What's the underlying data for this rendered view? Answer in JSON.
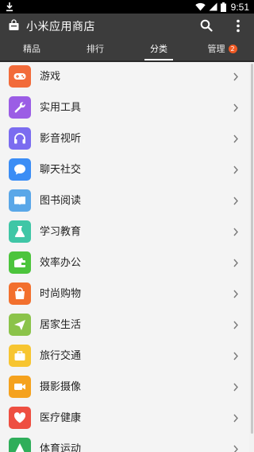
{
  "status_bar": {
    "time": "9:51"
  },
  "app_bar": {
    "title": "小米应用商店"
  },
  "tabs": [
    {
      "label": "精品"
    },
    {
      "label": "排行"
    },
    {
      "label": "分类"
    },
    {
      "label": "管理",
      "badge": "2"
    }
  ],
  "active_tab": "分类",
  "categories": [
    {
      "label": "游戏",
      "icon": "gamepad-icon",
      "color": "#f26b3a"
    },
    {
      "label": "实用工具",
      "icon": "wrench-icon",
      "color": "#9b5de5"
    },
    {
      "label": "影音视听",
      "icon": "headphones-icon",
      "color": "#7b6cf0"
    },
    {
      "label": "聊天社交",
      "icon": "chat-bubble-icon",
      "color": "#3b8df5"
    },
    {
      "label": "图书阅读",
      "icon": "book-icon",
      "color": "#5aa7e8"
    },
    {
      "label": "学习教育",
      "icon": "flask-icon",
      "color": "#3fc6a6"
    },
    {
      "label": "效率办公",
      "icon": "wallet-icon",
      "color": "#4cc43c"
    },
    {
      "label": "时尚购物",
      "icon": "shopping-bag-icon",
      "color": "#f2702e"
    },
    {
      "label": "居家生活",
      "icon": "paper-plane-icon",
      "color": "#8bc34a"
    },
    {
      "label": "旅行交通",
      "icon": "suitcase-icon",
      "color": "#f7c531"
    },
    {
      "label": "摄影摄像",
      "icon": "camera-icon",
      "color": "#f5a21e"
    },
    {
      "label": "医疗健康",
      "icon": "heart-icon",
      "color": "#ee4f41"
    },
    {
      "label": "体育运动",
      "icon": "sports-icon",
      "color": "#2fae5a"
    }
  ]
}
